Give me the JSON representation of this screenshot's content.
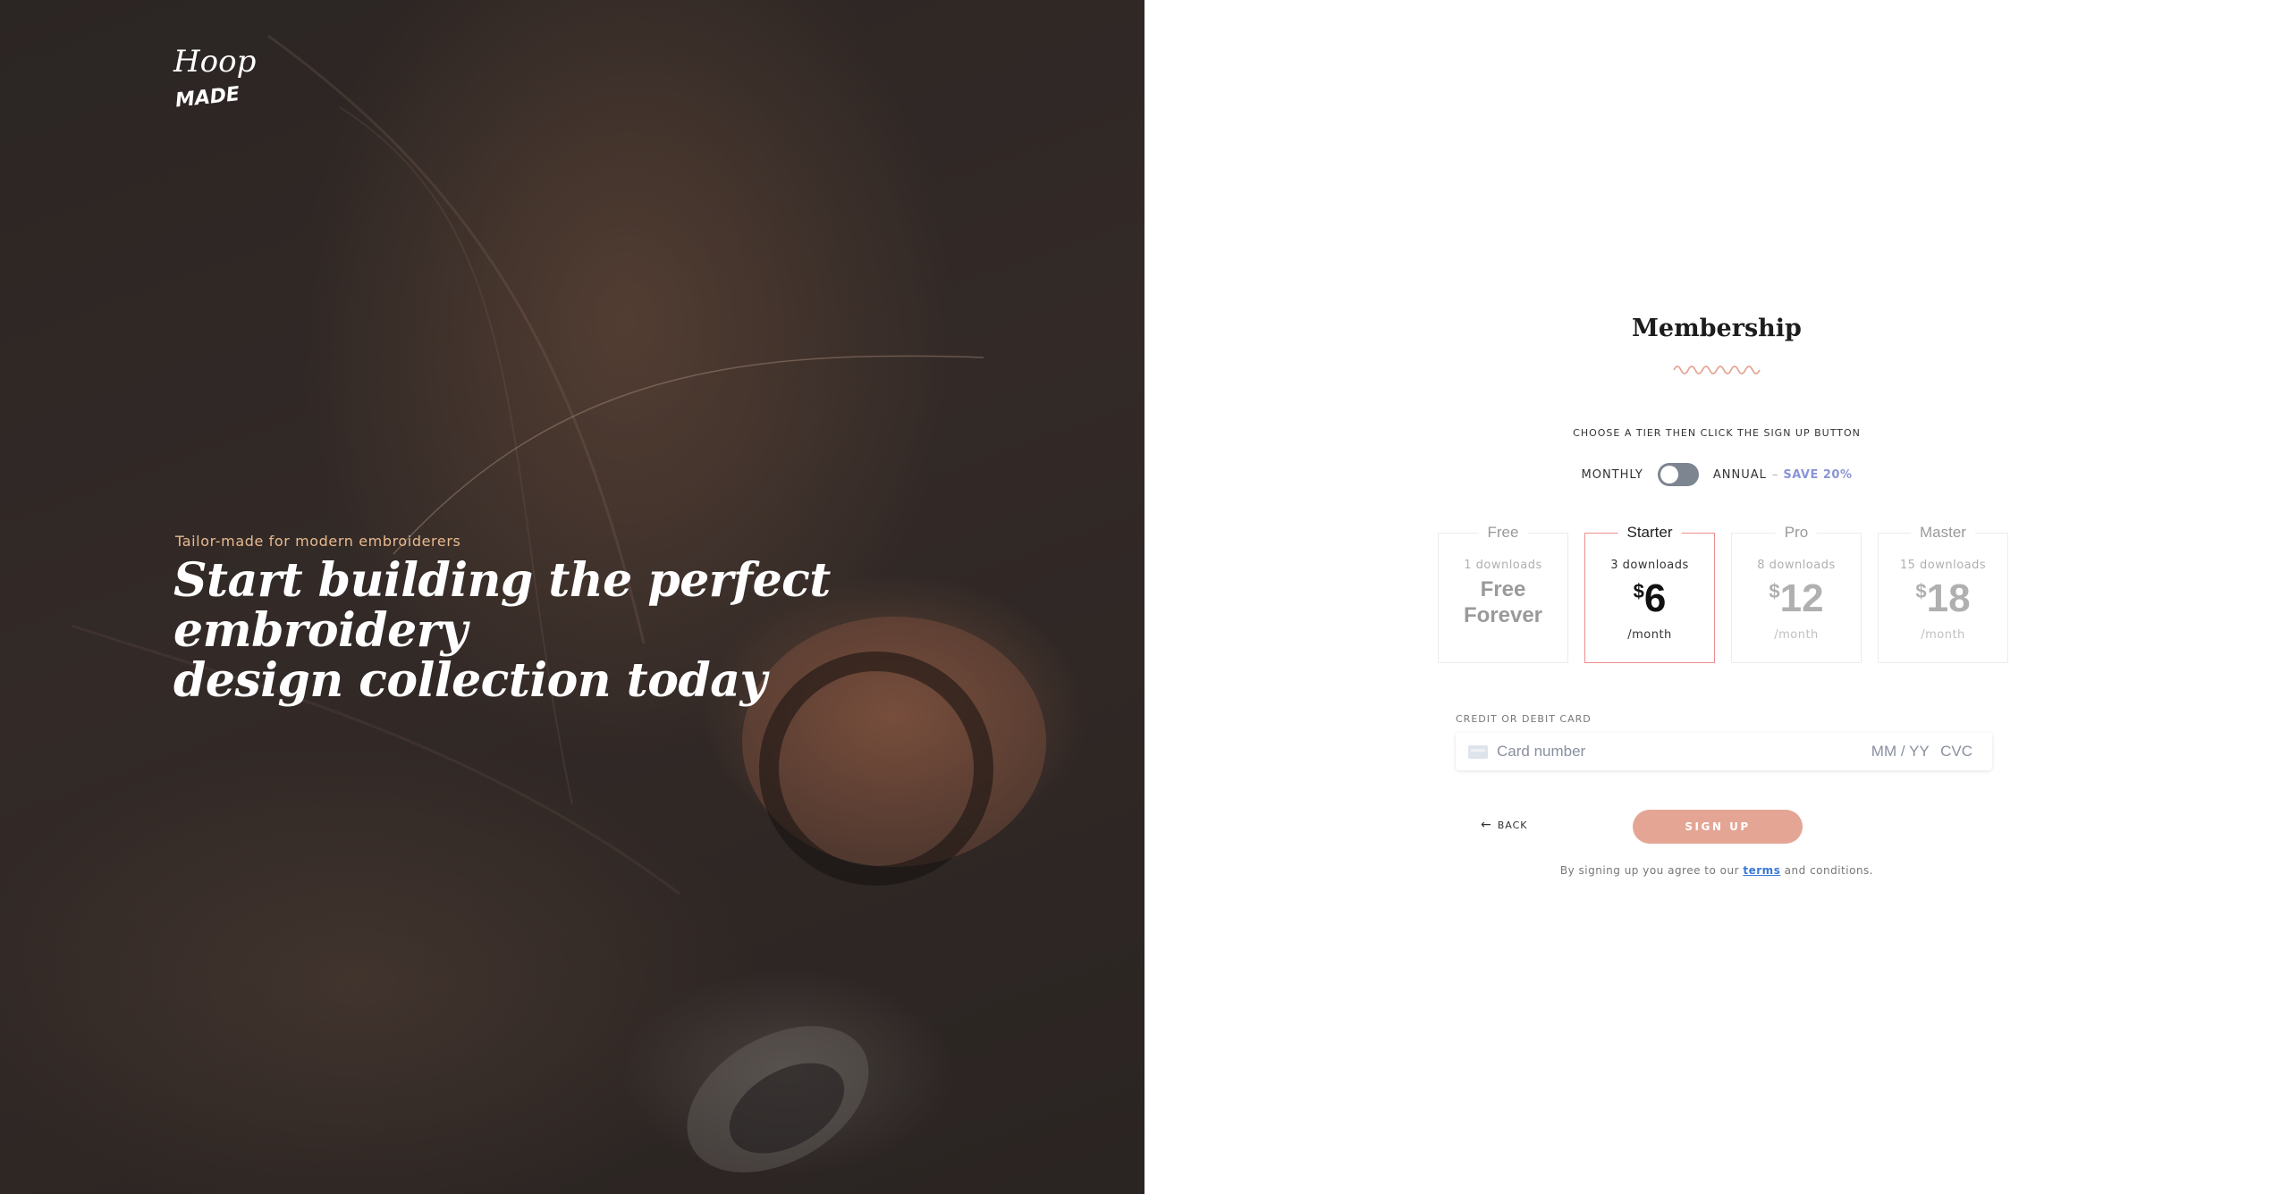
{
  "hero": {
    "logo_text_top": "Hoop",
    "logo_text_bottom": "MADE",
    "tagline": "Tailor-made for modern embroiderers",
    "headline_line1": "Start building the perfect embroidery",
    "headline_line2": "design collection today"
  },
  "membership": {
    "title": "Membership",
    "instructions": "CHOOSE A TIER THEN CLICK THE SIGN UP BUTTON",
    "billing": {
      "monthly_label": "MONTHLY",
      "annual_label": "ANNUAL",
      "separator": "–",
      "save_label": "SAVE 20%",
      "annual_selected": false
    },
    "tiers": [
      {
        "name": "Free",
        "downloads": "1 downloads",
        "free_line1": "Free",
        "free_line2": "Forever",
        "selected": false
      },
      {
        "name": "Starter",
        "downloads": "3 downloads",
        "currency": "$",
        "price": "6",
        "period": "/month",
        "selected": true
      },
      {
        "name": "Pro",
        "downloads": "8 downloads",
        "currency": "$",
        "price": "12",
        "period": "/month",
        "selected": false
      },
      {
        "name": "Master",
        "downloads": "15 downloads",
        "currency": "$",
        "price": "18",
        "period": "/month",
        "selected": false
      }
    ],
    "card": {
      "label": "CREDIT OR DEBIT CARD",
      "number_placeholder": "Card number",
      "expiry_placeholder": "MM / YY",
      "cvc_placeholder": "CVC"
    },
    "back_label": "BACK",
    "signup_label": "SIGN UP",
    "terms_prefix": "By signing up you agree to our",
    "terms_link": "terms",
    "terms_suffix": "and conditions."
  },
  "colors": {
    "accent": "#e4a595",
    "selected_border": "#ee8d8a",
    "save_color": "#8a95d6",
    "tagline_color": "#e8b98f",
    "toggle_color": "#7d8591"
  }
}
